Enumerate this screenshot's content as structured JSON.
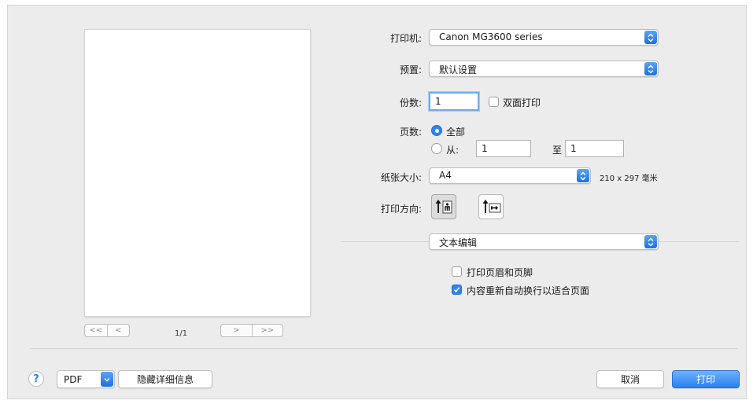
{
  "preview": {
    "page_indicator": "1/1",
    "nav_first": "<<",
    "nav_prev": "<",
    "nav_next": ">",
    "nav_last": ">>"
  },
  "printer": {
    "label": "打印机:",
    "value": "Canon MG3600 series"
  },
  "presets": {
    "label": "预置:",
    "value": "默认设置"
  },
  "copies": {
    "label": "份数:",
    "value": "1",
    "duplex_label": "双面打印",
    "duplex_checked": false
  },
  "pages": {
    "label": "页数:",
    "all_label": "全部",
    "from_label": "从:",
    "from_value": "1",
    "to_label": "至",
    "to_value": "1",
    "selected": "all"
  },
  "paper_size": {
    "label": "纸张大小:",
    "value": "A4",
    "dimensions": "210 x 297 毫米"
  },
  "orientation": {
    "label": "打印方向:",
    "selected": "portrait"
  },
  "section": {
    "value": "文本编辑",
    "header_footer_label": "打印页眉和页脚",
    "header_footer_checked": false,
    "rewrap_label": "内容重新自动换行以适合页面",
    "rewrap_checked": true
  },
  "footer": {
    "help": "?",
    "pdf_label": "PDF",
    "hide_details_label": "隐藏详细信息",
    "cancel_label": "取消",
    "print_label": "打印"
  },
  "colors": {
    "accent": "#2f84f1",
    "background": "#ececec"
  }
}
